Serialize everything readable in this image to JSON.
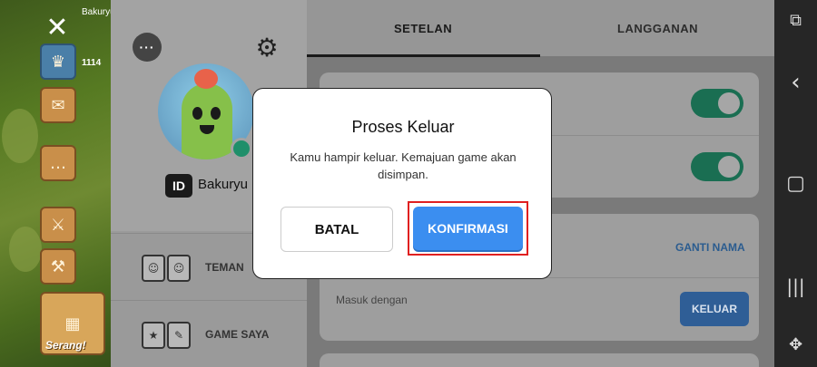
{
  "game": {
    "player_name": "Bakuryu",
    "trophies": "1114",
    "attack_label": "Serang!",
    "icons": [
      "close-icon",
      "trophy-icon",
      "mail-icon",
      "chat-icon",
      "battle-icon",
      "builder-icon",
      "map-icon"
    ]
  },
  "profile": {
    "username": "Bakuryu",
    "id_badge": "ID",
    "menu": [
      {
        "label": "TEMAN",
        "icon": "friends-icon"
      },
      {
        "label": "GAME SAYA",
        "icon": "my-games-icon"
      }
    ]
  },
  "settings": {
    "tabs": [
      {
        "label": "SETELAN",
        "active": true
      },
      {
        "label": "LANGGANAN",
        "active": false
      }
    ],
    "toggles": [
      true,
      true
    ],
    "rename_label": "GANTI NAMA",
    "login_with_label": "Masuk dengan",
    "logout_button": "KELUAR"
  },
  "dialog": {
    "title": "Proses Keluar",
    "message": "Kamu hampir keluar. Kemajuan game akan disimpan.",
    "cancel_label": "BATAL",
    "confirm_label": "KONFIRMASI"
  },
  "colors": {
    "confirm_blue": "#3b8ef0",
    "highlight_red": "#e02020",
    "toggle_green": "#1f9e74"
  },
  "navbar": {
    "icons": [
      "screenshot-icon",
      "back-icon",
      "home-icon",
      "recents-icon",
      "game-tools-icon"
    ]
  }
}
